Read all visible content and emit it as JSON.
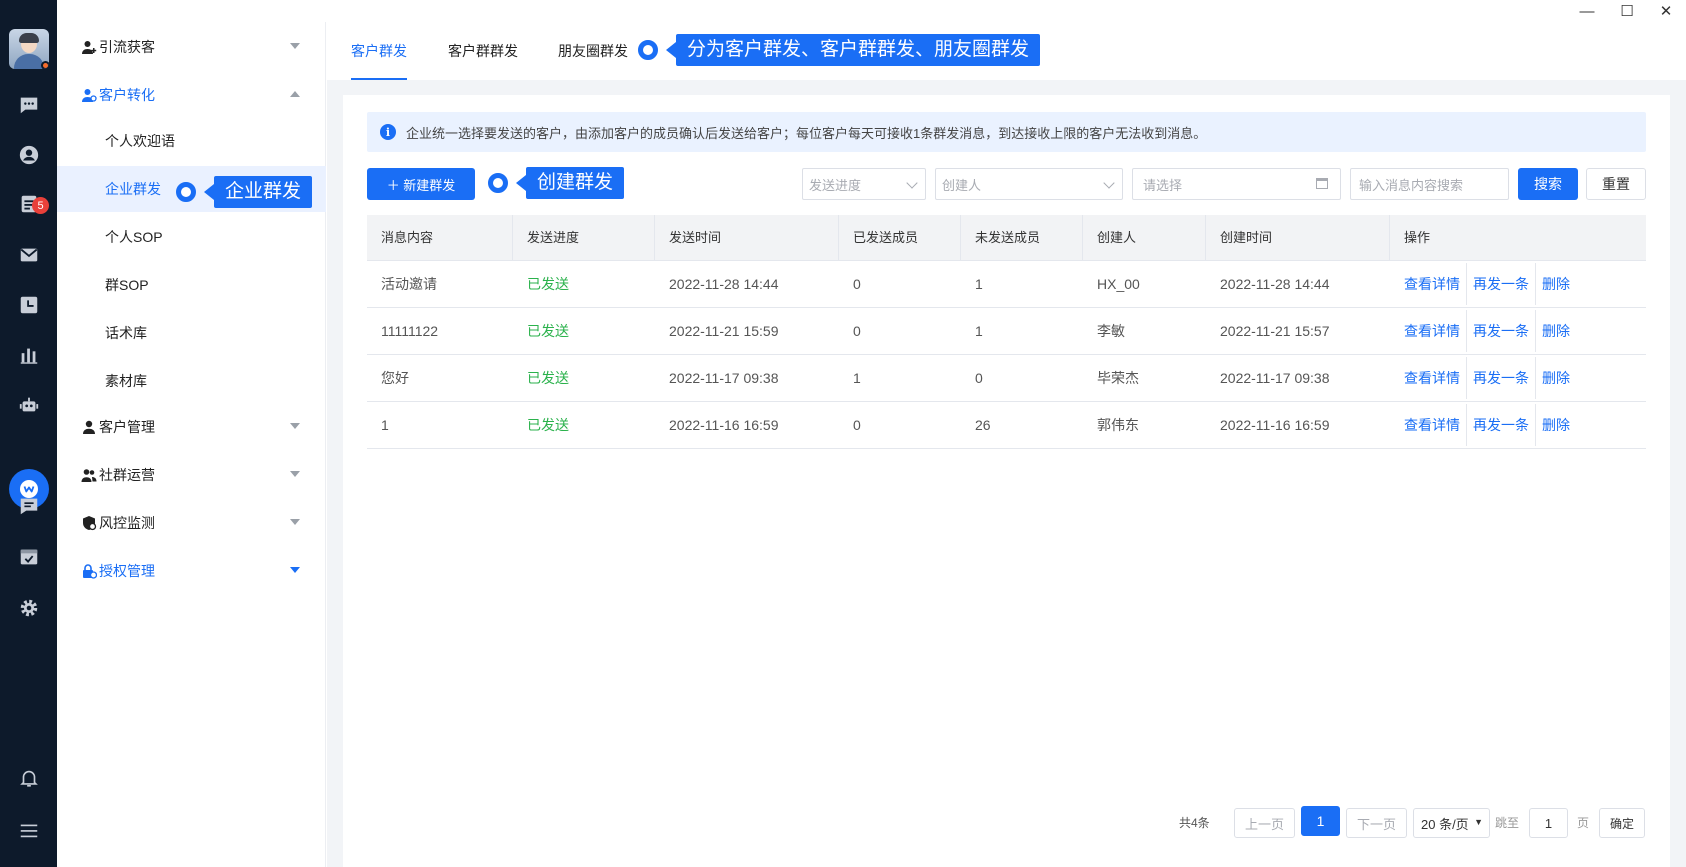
{
  "window": {
    "min": "—",
    "max": "☐",
    "close": "✕"
  },
  "rail": {
    "badge": "5"
  },
  "submenu": {
    "groups": [
      {
        "label": "引流获客"
      },
      {
        "label": "客户转化"
      },
      {
        "label": "客户管理"
      },
      {
        "label": "社群运营"
      },
      {
        "label": "风控监测"
      },
      {
        "label": "授权管理"
      }
    ],
    "items": [
      {
        "label": "个人欢迎语"
      },
      {
        "label": "企业群发"
      },
      {
        "label": "个人SOP"
      },
      {
        "label": "群SOP"
      },
      {
        "label": "话术库"
      },
      {
        "label": "素材库"
      }
    ]
  },
  "callouts": {
    "tabs": "分为客户群发、客户群群发、朋友圈群发",
    "menu": "企业群发",
    "create": "创建群发"
  },
  "tabs": [
    {
      "label": "客户群发"
    },
    {
      "label": "客户群群发"
    },
    {
      "label": "朋友圈群发"
    }
  ],
  "notice": {
    "icon": "i",
    "text": "企业统一选择要发送的客户，由添加客户的成员确认后发送给客户；每位客户每天可接收1条群发消息，到达接收上限的客户无法收到消息。"
  },
  "toolbar": {
    "new_label": "＋ 新建群发",
    "progress_placeholder": "发送进度",
    "creator_placeholder": "创建人",
    "date_placeholder": "请选择",
    "search_placeholder": "输入消息内容搜索",
    "search_label": "搜索",
    "reset_label": "重置"
  },
  "table": {
    "headers": [
      "消息内容",
      "发送进度",
      "发送时间",
      "已发送成员",
      "未发送成员",
      "创建人",
      "创建时间",
      "操作"
    ],
    "rows": [
      {
        "content": "活动邀请",
        "status": "已发送",
        "send_time": "2022-11-28 14:44",
        "sent": "0",
        "unsent": "1",
        "creator": "HX_00",
        "created": "2022-11-28 14:44"
      },
      {
        "content": "11111122",
        "status": "已发送",
        "send_time": "2022-11-21 15:59",
        "sent": "0",
        "unsent": "1",
        "creator": "李敏",
        "created": "2022-11-21 15:57"
      },
      {
        "content": "您好",
        "status": "已发送",
        "send_time": "2022-11-17 09:38",
        "sent": "1",
        "unsent": "0",
        "creator": "毕荣杰",
        "created": "2022-11-17 09:38"
      },
      {
        "content": "1",
        "status": "已发送",
        "send_time": "2022-11-16 16:59",
        "sent": "0",
        "unsent": "26",
        "creator": "郭伟东",
        "created": "2022-11-16 16:59"
      }
    ],
    "ops": {
      "detail": "查看详情",
      "resend": "再发一条",
      "delete": "删除"
    }
  },
  "pager": {
    "total": "共4条",
    "prev": "上一页",
    "current": "1",
    "next": "下一页",
    "page_size": "20 条/页",
    "jump_label": "跳至",
    "jump_value": "1",
    "page_unit": "页",
    "confirm": "确定"
  },
  "colors": {
    "primary": "#1a6ef5",
    "rail": "#0d1a2b",
    "success": "#2bb24c"
  }
}
